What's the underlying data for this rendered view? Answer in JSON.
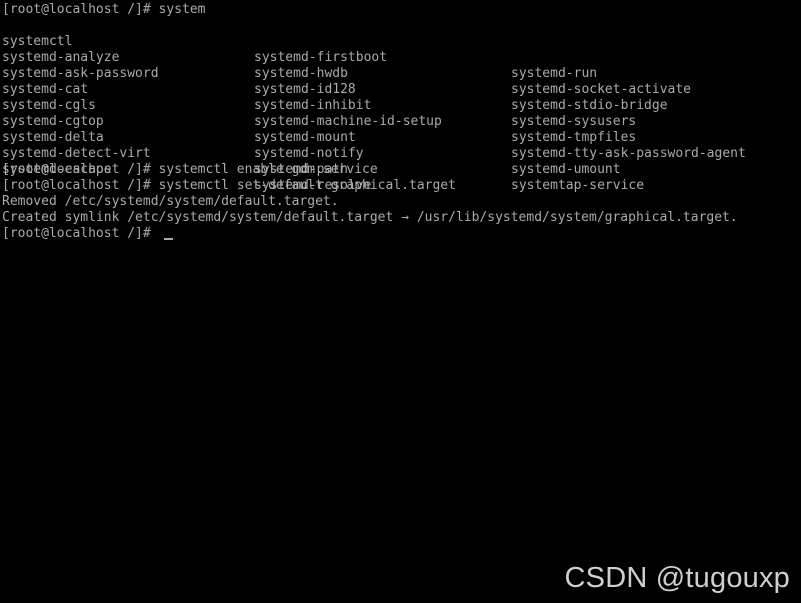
{
  "terminal": {
    "background_color": "#000000",
    "text_color": "#aaaaaa",
    "prompt_line_1": "[root@localhost /]# system",
    "completion_columns": {
      "rows": [
        {
          "c1": "systemctl",
          "c2": "systemd-firstboot",
          "c3": "systemd-run"
        },
        {
          "c1": "systemd-analyze",
          "c2": "systemd-hwdb",
          "c3": "systemd-socket-activate"
        },
        {
          "c1": "systemd-ask-password",
          "c2": "systemd-id128",
          "c3": "systemd-stdio-bridge"
        },
        {
          "c1": "systemd-cat",
          "c2": "systemd-inhibit",
          "c3": "systemd-sysusers"
        },
        {
          "c1": "systemd-cgls",
          "c2": "systemd-machine-id-setup",
          "c3": "systemd-tmpfiles"
        },
        {
          "c1": "systemd-cgtop",
          "c2": "systemd-mount",
          "c3": "systemd-tty-ask-password-agent"
        },
        {
          "c1": "systemd-delta",
          "c2": "systemd-notify",
          "c3": "systemd-umount"
        },
        {
          "c1": "systemd-detect-virt",
          "c2": "systemd-path",
          "c3": "systemtap-service"
        },
        {
          "c1": "systemd-escape",
          "c2": "systemd-resolve",
          "c3": ""
        }
      ]
    },
    "command_lines": [
      "[root@localhost /]# systemctl enable gdm.service",
      "[root@localhost /]# systemctl set-default graphical.target",
      "Removed /etc/systemd/system/default.target.",
      "Created symlink /etc/systemd/system/default.target → /usr/lib/systemd/system/graphical.target.",
      "[root@localhost /]# "
    ],
    "cursor": {
      "glyph": "_",
      "visible": true
    }
  },
  "watermark": {
    "text": "CSDN @tugouxp"
  }
}
